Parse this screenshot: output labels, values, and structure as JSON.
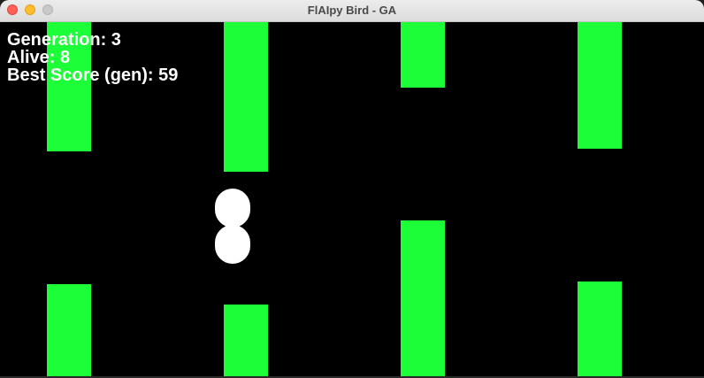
{
  "window": {
    "title": "FlAIpy Bird - GA"
  },
  "hud": {
    "generation_label": "Generation: 3",
    "alive_label": "Alive: 8",
    "best_score_label": "Best Score (gen): 59"
  },
  "game": {
    "generation": 3,
    "alive": 8,
    "best_score_gen": 59,
    "colors": {
      "background": "#000000",
      "pipe": "#1cff38",
      "bird": "#ffffff",
      "hud_text": "#ffffff"
    }
  }
}
